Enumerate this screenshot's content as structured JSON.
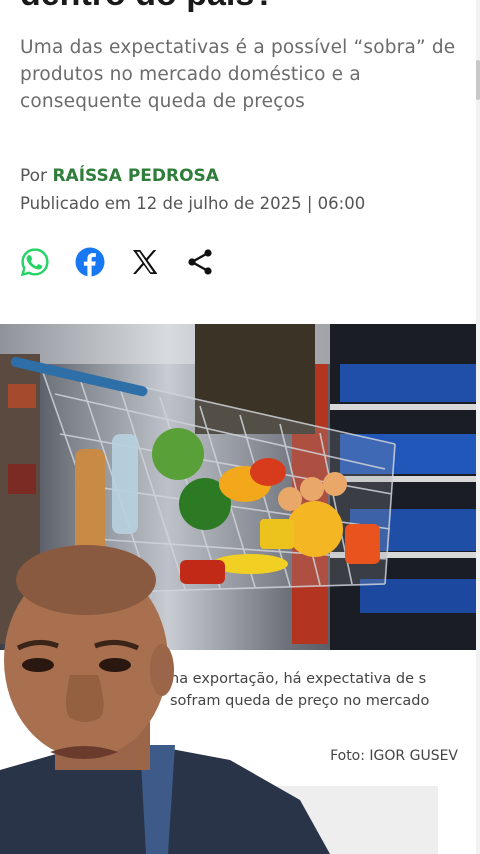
{
  "article": {
    "headline": "dentro do país?",
    "subtitle": "Uma das expectativas é a possível “sobra” de produtos no mercado doméstico e a consequente queda de preços",
    "byline_prefix": "Por ",
    "author": "RAÍSSA PEDROSA",
    "published": "Publicado em 12 de julho de 2025 | 06:00"
  },
  "share": {
    "icons": [
      "whatsapp-icon",
      "facebook-icon",
      "x-icon",
      "share-icon"
    ],
    "colors": {
      "whatsapp": "#25D366",
      "facebook": "#1877F2",
      "x": "#111111",
      "share": "#111111"
    }
  },
  "photo": {
    "caption": "na exportação, há expectativa de s sofram queda de preço no mercado",
    "credit": "Foto: IGOR GUSEV"
  },
  "colors": {
    "author": "#2e7d3a",
    "text": "#1a1a1a",
    "muted": "#6b6b6b"
  }
}
